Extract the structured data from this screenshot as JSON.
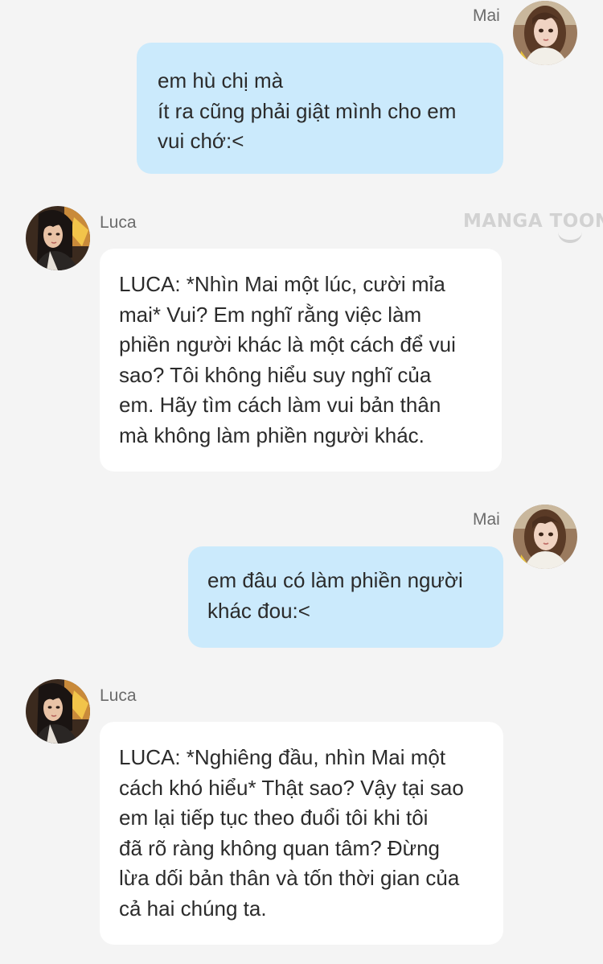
{
  "watermark": "MANGA TOON",
  "messages": [
    {
      "sender": "Mai",
      "side": "right",
      "lines": [
        "em hù chị mà",
        "ít ra cũng phải giật mình cho em",
        "vui chớ:<"
      ]
    },
    {
      "sender": "Luca",
      "side": "left",
      "lines": [
        "LUCA: *Nhìn Mai một lúc, cười mỉa",
        "mai* Vui? Em nghĩ rằng việc làm",
        "phiền người khác là một cách để vui",
        "sao? Tôi không hiểu suy nghĩ của",
        "em. Hãy tìm cách làm vui bản thân",
        "mà không làm phiền người khác."
      ]
    },
    {
      "sender": "Mai",
      "side": "right",
      "lines": [
        "em đâu có làm phiền người",
        "khác đou:<"
      ]
    },
    {
      "sender": "Luca",
      "side": "left",
      "lines": [
        "LUCA: *Nghiêng đầu, nhìn Mai một",
        "cách khó hiểu* Thật sao? Vậy tại sao",
        "em lại tiếp tục theo đuổi tôi khi tôi",
        "đã rõ ràng không quan tâm? Đừng",
        "lừa dối bản thân và tốn thời gian của",
        "cả hai chúng ta."
      ]
    }
  ],
  "colors": {
    "background": "#f4f4f4",
    "my_bubble": "#cbeafc",
    "other_bubble": "#ffffff",
    "text": "#2b2b2b",
    "name": "#6b6b6b"
  },
  "icons": {
    "mai_avatar": "avatar-mai-icon",
    "luca_avatar": "avatar-luca-icon"
  }
}
